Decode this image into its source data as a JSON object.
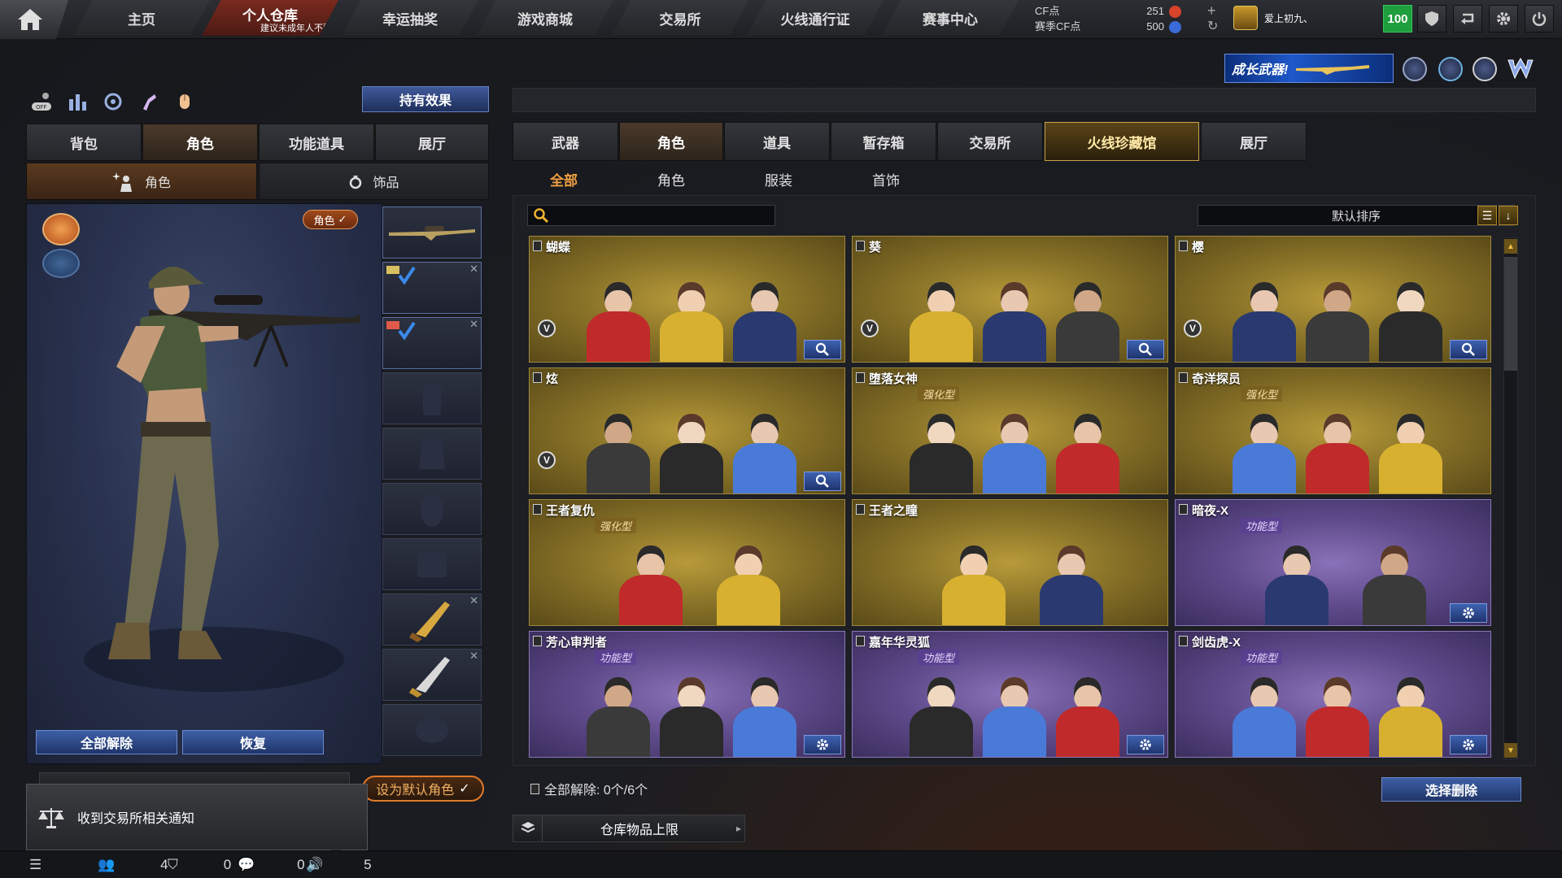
{
  "nav": {
    "tabs": [
      {
        "label": "主页"
      },
      {
        "label": "个人仓库",
        "sub": "建议未成年人不要进入"
      },
      {
        "label": "幸运抽奖"
      },
      {
        "label": "游戏商城"
      },
      {
        "label": "交易所"
      },
      {
        "label": "火线通行证"
      },
      {
        "label": "赛事中心"
      }
    ],
    "currency": {
      "cf_label": "CF点",
      "cf_value": "251",
      "match_label": "赛季CF点",
      "match_value": "500"
    },
    "player_name": "爱上初九、",
    "level": "100"
  },
  "banner_text": "成长武器!",
  "left": {
    "effect_button": "持有效果",
    "tabs": [
      "背包",
      "角色",
      "功能道具",
      "展厅"
    ],
    "subtabs": [
      "角色",
      "饰品"
    ],
    "role_pill": "角色",
    "release_all": "全部解除",
    "restore": "恢复",
    "set_default": "设为默认角色",
    "notice": "收到交易所相关通知"
  },
  "right": {
    "tabs": [
      "武器",
      "角色",
      "道具",
      "暂存箱",
      "交易所",
      "火线珍藏馆",
      "展厅"
    ],
    "filters": [
      "全部",
      "角色",
      "服装",
      "首饰"
    ],
    "search_placeholder": "",
    "sort_label": "默认排序",
    "release_status": "全部解除: 0个/6个",
    "select_delete": "选择删除",
    "capacity": "仓库物品上限",
    "cards": [
      {
        "name": "蝴蝶",
        "tag": "",
        "theme": "gold",
        "button": "search"
      },
      {
        "name": "葵",
        "tag": "",
        "theme": "gold",
        "button": "search"
      },
      {
        "name": "樱",
        "tag": "",
        "theme": "gold",
        "button": "search"
      },
      {
        "name": "炫",
        "tag": "",
        "theme": "gold",
        "button": "search"
      },
      {
        "name": "堕落女神",
        "tag": "强化型",
        "theme": "gold",
        "button": ""
      },
      {
        "name": "奇洋探员",
        "tag": "强化型",
        "theme": "gold",
        "button": ""
      },
      {
        "name": "王者复仇",
        "tag": "强化型",
        "theme": "gold",
        "button": ""
      },
      {
        "name": "王者之瞳",
        "tag": "",
        "theme": "gold",
        "button": ""
      },
      {
        "name": "暗夜-X",
        "tag": "功能型",
        "theme": "purple",
        "button": "gear"
      },
      {
        "name": "芳心审判者",
        "tag": "功能型",
        "theme": "purple",
        "button": "gear"
      },
      {
        "name": "嘉年华灵狐",
        "tag": "功能型",
        "theme": "purple",
        "button": "gear"
      },
      {
        "name": "剑齿虎-X",
        "tag": "功能型",
        "theme": "purple",
        "button": "gear"
      }
    ]
  },
  "statusbar": {
    "friends": "4",
    "team": "0",
    "chat": "0",
    "voice": "5"
  }
}
